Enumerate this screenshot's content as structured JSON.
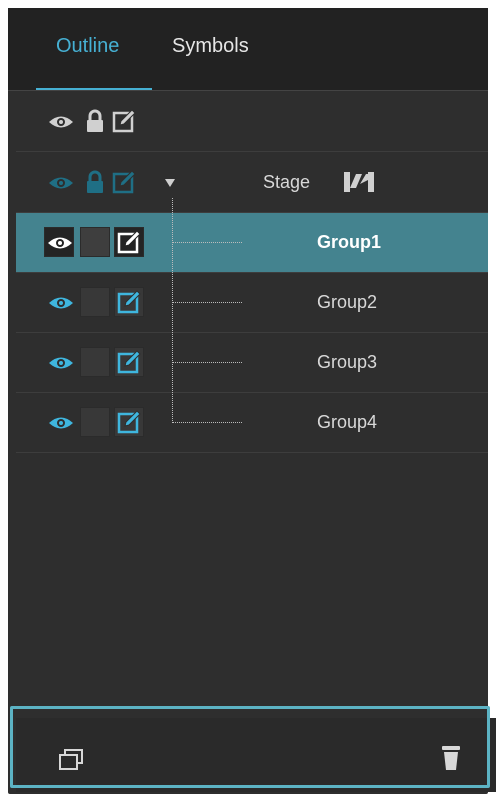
{
  "tabs": [
    {
      "label": "Outline",
      "active": true
    },
    {
      "label": "Symbols",
      "active": false
    }
  ],
  "colors": {
    "accent": "#46b0d3",
    "selected_row": "#44838f",
    "panel_bg": "#2e2e2e",
    "footer_highlight": "#5cb3c4"
  },
  "outline": {
    "header_icons": [
      "eye-icon",
      "lock-icon",
      "edit-icon"
    ],
    "stage": {
      "label": "Stage",
      "icon": "stage-icon",
      "expanded": true
    },
    "items": [
      {
        "label": "Group1",
        "selected": true
      },
      {
        "label": "Group2",
        "selected": false
      },
      {
        "label": "Group3",
        "selected": false
      },
      {
        "label": "Group4",
        "selected": false
      }
    ]
  },
  "footer": {
    "icons": [
      "duplicate-icon",
      "trash-icon"
    ]
  }
}
